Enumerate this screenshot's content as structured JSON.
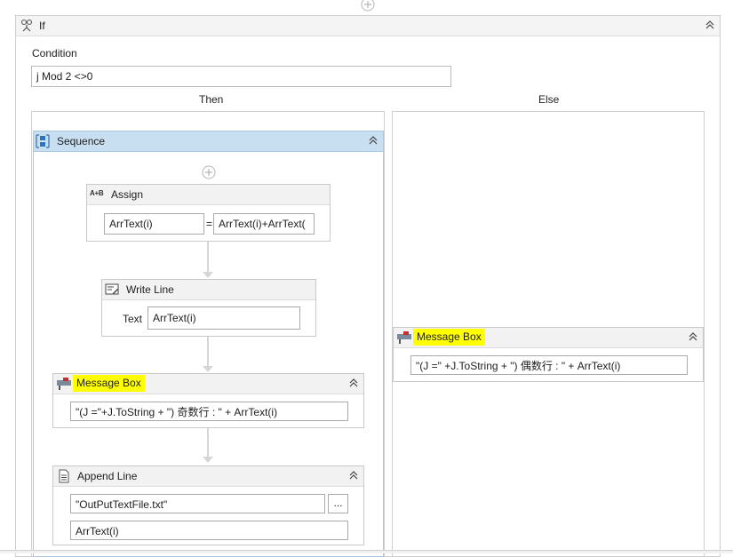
{
  "if_activity": {
    "title": "If",
    "condition_label": "Condition",
    "condition_value": "j Mod 2 <>0",
    "then_label": "Then",
    "else_label": "Else"
  },
  "sequence": {
    "title": "Sequence"
  },
  "assign": {
    "title": "Assign",
    "icon_text": "A+B",
    "to_value": "ArrText(i)",
    "equals": "=",
    "value": "ArrText(i)+ArrText("
  },
  "write_line": {
    "title": "Write Line",
    "text_label": "Text",
    "text_value": "ArrText(i)"
  },
  "message_box_then": {
    "title": "Message Box",
    "text_value": "\"(J =\"+J.ToString + \") 奇数行 : \" + ArrText(i)"
  },
  "append_line": {
    "title": "Append Line",
    "file_value": "\"OutPutTextFile.txt\"",
    "browse_label": "...",
    "text_value": "ArrText(i)"
  },
  "message_box_else": {
    "title": "Message Box",
    "text_value": "\"(J =\" +J.ToString + \") 偶数行 : \" + ArrText(i)"
  },
  "colors": {
    "sequence_header": "#c8dff2",
    "highlight": "#ffff00",
    "border": "#c9c9c9"
  }
}
